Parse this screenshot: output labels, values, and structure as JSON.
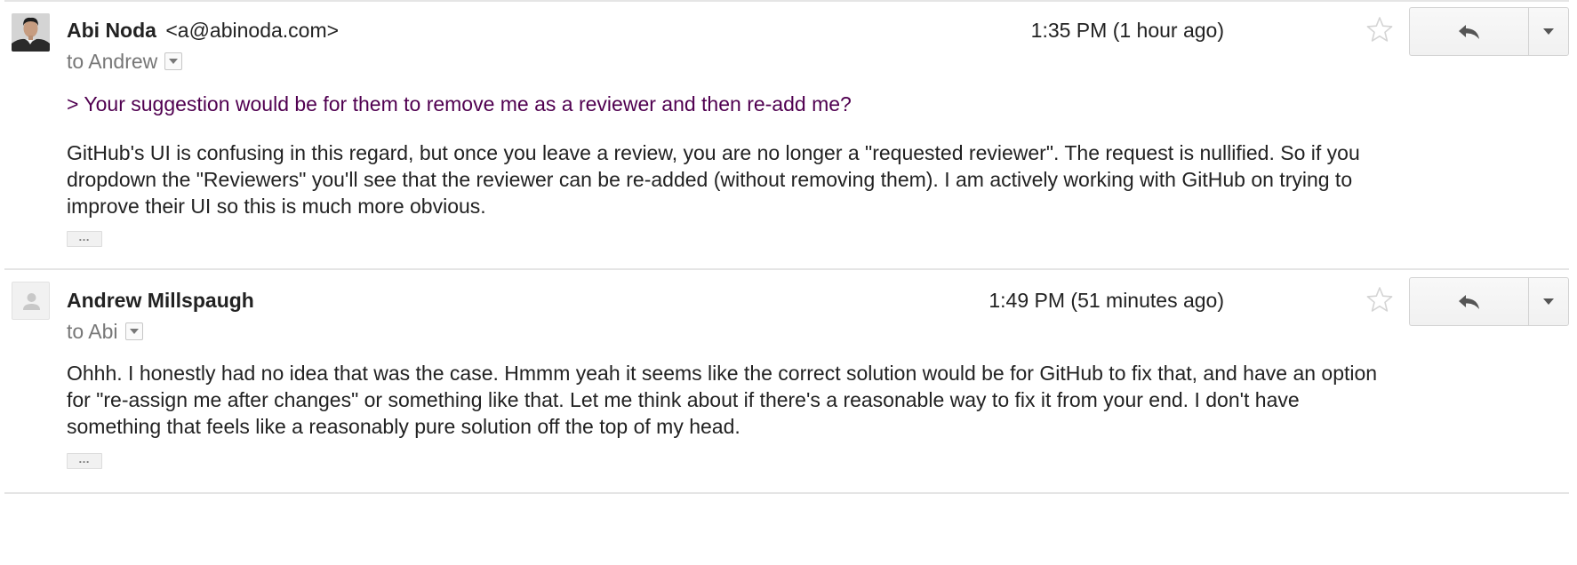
{
  "messages": [
    {
      "sender_name": "Abi Noda",
      "sender_email": "<a@abinoda.com>",
      "recipient": "to Andrew",
      "time": "1:35 PM (1 hour ago)",
      "quoted": "> Your suggestion would be for them to remove me as a reviewer and then re-add me?",
      "body": [
        "GitHub's UI is confusing in this regard, but once you leave a review, you are no longer a \"requested reviewer\". The request is nullified. So if you",
        "dropdown the \"Reviewers\" you'll see that the reviewer can be re-added (without removing them). I am actively working with GitHub on trying to",
        "improve their UI so this is much more obvious."
      ],
      "trimmed_label": "…"
    },
    {
      "sender_name": "Andrew Millspaugh",
      "recipient": "to Abi",
      "time": "1:49 PM (51 minutes ago)",
      "body": [
        "Ohhh. I honestly had no idea that was the case. Hmmm yeah it seems like the correct solution would be for GitHub to fix that, and have an option",
        "for \"re-assign me after changes\" or something like that. Let me think about if there's a reasonable way to fix it from your end. I don't have",
        "something that feels like a reasonably pure solution off the top of my head."
      ],
      "trimmed_label": "…"
    }
  ],
  "icons": {
    "star": "star-icon",
    "reply": "reply-icon",
    "more": "chevron-down-icon",
    "details": "caret-down-icon"
  },
  "colors": {
    "quoted_text": "#500050",
    "recipient_text": "#777777",
    "body_text": "#222222"
  }
}
